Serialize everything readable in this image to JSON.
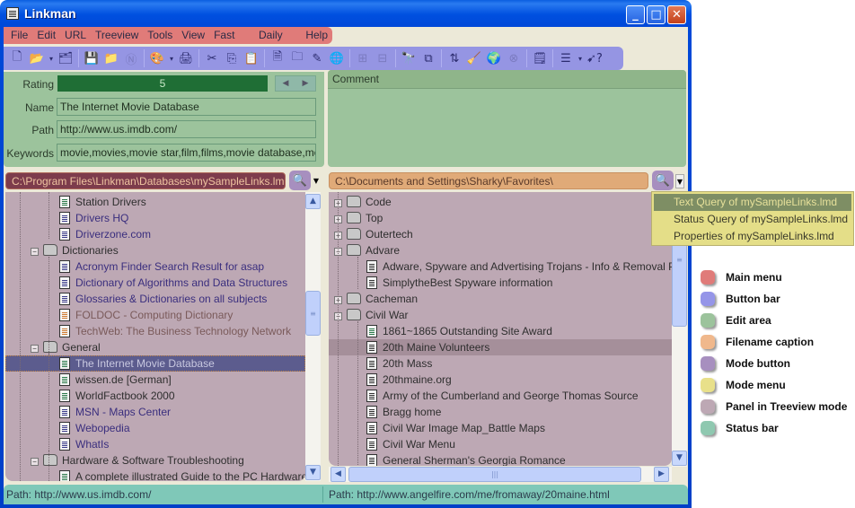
{
  "window": {
    "title": "Linkman",
    "controls": {
      "minimize": "_",
      "maximize": "□",
      "close": "✕"
    }
  },
  "menu": [
    "File",
    "Edit",
    "URL",
    "Treeview",
    "Tools",
    "View",
    "Fast Links",
    "Daily Links",
    "Help"
  ],
  "toolbar": {
    "buttons": [
      {
        "name": "new-file-icon",
        "glyph": "🗋",
        "dim": false
      },
      {
        "name": "open-folder-icon",
        "glyph": "📂",
        "dim": false
      },
      {
        "name": "dropdown-arrow-icon",
        "glyph": "▾",
        "dim": false,
        "small": true
      },
      {
        "name": "new-database-icon",
        "glyph": "🗂",
        "dim": false
      },
      {
        "name": "sep"
      },
      {
        "name": "save-icon",
        "glyph": "💾",
        "dim": true
      },
      {
        "name": "folder-icon",
        "glyph": "📁",
        "dim": true
      },
      {
        "name": "n-circle-icon",
        "glyph": "Ⓝ",
        "dim": true
      },
      {
        "name": "sep"
      },
      {
        "name": "browser-icon",
        "glyph": "🎨",
        "dim": false
      },
      {
        "name": "dropdown-arrow-icon",
        "glyph": "▾",
        "dim": false,
        "small": true
      },
      {
        "name": "print-icon",
        "glyph": "🖨",
        "dim": false
      },
      {
        "name": "sep"
      },
      {
        "name": "cut-icon",
        "glyph": "✂",
        "dim": false
      },
      {
        "name": "copy-icon",
        "glyph": "⎘",
        "dim": false
      },
      {
        "name": "paste-icon",
        "glyph": "📋",
        "dim": true
      },
      {
        "name": "sep"
      },
      {
        "name": "add-link-icon",
        "glyph": "🗎",
        "dim": false
      },
      {
        "name": "add-folder-icon",
        "glyph": "🗀",
        "dim": false
      },
      {
        "name": "edit-icon",
        "glyph": "✎",
        "dim": false
      },
      {
        "name": "globe-link-icon",
        "glyph": "🌐",
        "dim": false
      },
      {
        "name": "sep"
      },
      {
        "name": "expand-icon",
        "glyph": "⊞",
        "dim": true
      },
      {
        "name": "collapse-icon",
        "glyph": "⊟",
        "dim": true
      },
      {
        "name": "sep"
      },
      {
        "name": "find-icon",
        "glyph": "🔭",
        "dim": false
      },
      {
        "name": "filter-icon",
        "glyph": "⧉",
        "dim": false
      },
      {
        "name": "sep"
      },
      {
        "name": "sort-az-icon",
        "glyph": "⇅",
        "dim": false
      },
      {
        "name": "clean-icon",
        "glyph": "🧹",
        "dim": false
      },
      {
        "name": "check-links-icon",
        "glyph": "🌍",
        "dim": false
      },
      {
        "name": "stop-icon",
        "glyph": "⊗",
        "dim": true
      },
      {
        "name": "sep"
      },
      {
        "name": "properties-icon",
        "glyph": "🗒",
        "dim": false
      },
      {
        "name": "sep"
      },
      {
        "name": "view-icon",
        "glyph": "☰",
        "dim": false
      },
      {
        "name": "dropdown-arrow-icon",
        "glyph": "▾",
        "dim": false,
        "small": true
      },
      {
        "name": "help-pointer-icon",
        "glyph": "➹?",
        "dim": false
      }
    ]
  },
  "edit_area": {
    "rating_label": "Rating",
    "rating_value": "5",
    "name_label": "Name",
    "name_value": "The Internet Movie Database",
    "path_label": "Path",
    "path_value": "http://www.us.imdb.com/",
    "keywords_label": "Keywords",
    "keywords_value": "movie,movies,movie star,film,films,movie database,movie r",
    "comment_label": "Comment",
    "comment_value": ""
  },
  "left_panel": {
    "filename": "C:\\Program Files\\Linkman\\Databases\\mySampleLinks.lmd",
    "nodes": [
      {
        "label": "Station Drivers",
        "type": "link",
        "icon": "green",
        "color": "dark",
        "level": 2
      },
      {
        "label": "Drivers HQ",
        "type": "link",
        "icon": "blue",
        "color": "blue",
        "level": 2
      },
      {
        "label": "Driverzone.com",
        "type": "link",
        "icon": "blue",
        "color": "blue",
        "level": 2
      },
      {
        "label": "Dictionaries",
        "type": "folder",
        "expanded": true,
        "level": 1
      },
      {
        "label": "Acronym Finder Search Result for asap",
        "type": "link",
        "icon": "blue",
        "color": "blue",
        "level": 2
      },
      {
        "label": "Dictionary of Algorithms and Data Structures",
        "type": "link",
        "icon": "blue",
        "color": "blue",
        "level": 2
      },
      {
        "label": "Glossaries & Dictionaries on all subjects",
        "type": "link",
        "icon": "blue",
        "color": "blue",
        "level": 2
      },
      {
        "label": "FOLDOC - Computing Dictionary",
        "type": "link",
        "icon": "orange",
        "color": "orange",
        "level": 2
      },
      {
        "label": "TechWeb: The Business Technology Network",
        "type": "link",
        "icon": "orange",
        "color": "orange",
        "level": 2
      },
      {
        "label": "General",
        "type": "folder",
        "expanded": true,
        "level": 1
      },
      {
        "label": "The Internet Movie Database",
        "type": "link",
        "icon": "green",
        "color": "selected",
        "level": 2,
        "selected": true
      },
      {
        "label": "wissen.de [German]",
        "type": "link",
        "icon": "green",
        "color": "dark",
        "level": 2
      },
      {
        "label": "WorldFactbook 2000",
        "type": "link",
        "icon": "green",
        "color": "dark",
        "level": 2
      },
      {
        "label": "MSN - Maps Center",
        "type": "link",
        "icon": "blue",
        "color": "blue",
        "level": 2
      },
      {
        "label": "Webopedia",
        "type": "link",
        "icon": "blue",
        "color": "blue",
        "level": 2
      },
      {
        "label": "WhatIs",
        "type": "link",
        "icon": "blue",
        "color": "blue",
        "level": 2
      },
      {
        "label": "Hardware & Software Troubleshooting",
        "type": "folder",
        "expanded": true,
        "level": 1
      },
      {
        "label": "A complete illustrated Guide to the PC Hardware",
        "type": "link",
        "icon": "green",
        "color": "dark",
        "level": 2
      }
    ],
    "status": "Path: http://www.us.imdb.com/"
  },
  "right_panel": {
    "filename": "C:\\Documents and Settings\\Sharky\\Favorites\\",
    "nodes": [
      {
        "label": "Code",
        "type": "folder",
        "expanded": false,
        "level": 1
      },
      {
        "label": "Top",
        "type": "folder",
        "expanded": false,
        "level": 1
      },
      {
        "label": "Outertech",
        "type": "folder",
        "expanded": false,
        "level": 1
      },
      {
        "label": "Advare",
        "type": "folder",
        "expanded": true,
        "level": 1
      },
      {
        "label": "Adware, Spyware and Advertising Trojans - Info & Removal Procedures",
        "type": "link",
        "icon": "plain",
        "color": "dark",
        "level": 2
      },
      {
        "label": "SimplytheBest Spyware information",
        "type": "link",
        "icon": "plain",
        "color": "dark",
        "level": 2
      },
      {
        "label": "Cacheman",
        "type": "folder",
        "expanded": false,
        "level": 1
      },
      {
        "label": "Civil War",
        "type": "folder",
        "expanded": true,
        "level": 1
      },
      {
        "label": "1861~1865 Outstanding Site Award",
        "type": "link",
        "icon": "green",
        "color": "dark",
        "level": 2
      },
      {
        "label": "20th Maine Volunteers",
        "type": "link",
        "icon": "plain",
        "color": "dark",
        "level": 2,
        "selected": true
      },
      {
        "label": "20th Mass",
        "type": "link",
        "icon": "plain",
        "color": "dark",
        "level": 2
      },
      {
        "label": "20thmaine.org",
        "type": "link",
        "icon": "plain",
        "color": "dark",
        "level": 2
      },
      {
        "label": "Army of the Cumberland and George Thomas Source",
        "type": "link",
        "icon": "plain",
        "color": "dark",
        "level": 2
      },
      {
        "label": "Bragg home",
        "type": "link",
        "icon": "plain",
        "color": "dark",
        "level": 2
      },
      {
        "label": "Civil War Image Map_Battle Maps",
        "type": "link",
        "icon": "plain",
        "color": "dark",
        "level": 2
      },
      {
        "label": "Civil War Menu",
        "type": "link",
        "icon": "plain",
        "color": "dark",
        "level": 2
      },
      {
        "label": "General Sherman's Georgia Romance",
        "type": "link",
        "icon": "plain",
        "color": "dark",
        "level": 2
      }
    ],
    "status": "Path: http://www.angelfire.com/me/fromaway/20maine.html"
  },
  "mode_menu": [
    {
      "label": "Text Query of mySampleLinks.lmd",
      "active": true
    },
    {
      "label": "Status Query of mySampleLinks.lmd",
      "active": false
    },
    {
      "label": "Properties of mySampleLinks.lmd",
      "active": false
    }
  ],
  "legend": [
    {
      "label": "Main menu",
      "color": "#e07b79"
    },
    {
      "label": "Button bar",
      "color": "#9595e8"
    },
    {
      "label": "Edit area",
      "color": "#9cc39c"
    },
    {
      "label": "Filename caption",
      "color": "#f0b88c"
    },
    {
      "label": "Mode button",
      "color": "#a78fbf"
    },
    {
      "label": "Mode menu",
      "color": "#e8e08a"
    },
    {
      "label": "Panel in Treeview mode",
      "color": "#bda8b4"
    },
    {
      "label": "Status bar",
      "color": "#8fc8b0"
    }
  ]
}
